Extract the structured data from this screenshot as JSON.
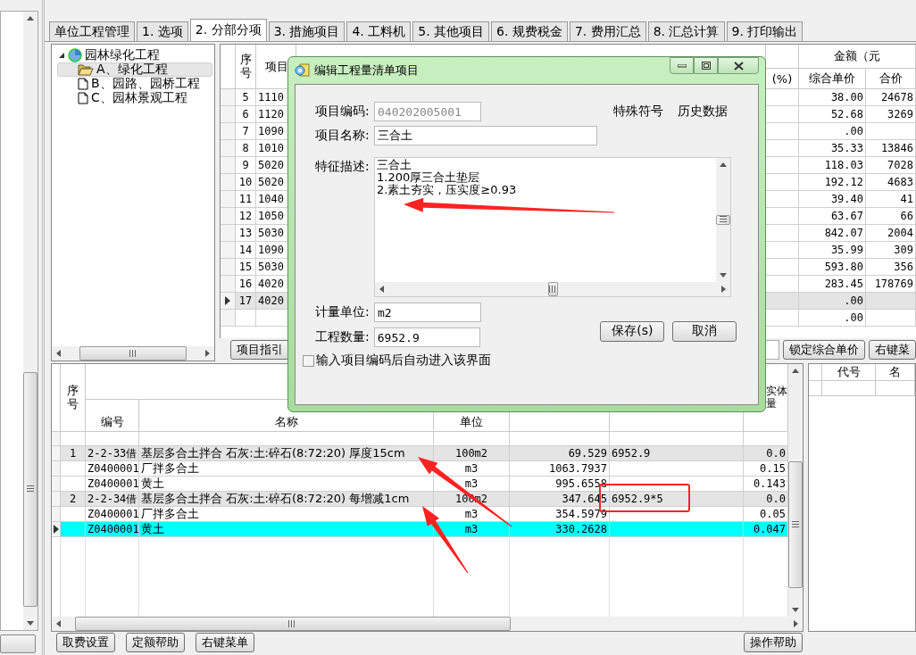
{
  "tabs": [
    {
      "label": "单位工程管理",
      "selected": false
    },
    {
      "label": "1. 选项",
      "selected": false
    },
    {
      "label": "2. 分部分项",
      "selected": true
    },
    {
      "label": "3. 措施项目",
      "selected": false
    },
    {
      "label": "4. 工料机",
      "selected": false
    },
    {
      "label": "5. 其他项目",
      "selected": false
    },
    {
      "label": "6. 规费税金",
      "selected": false
    },
    {
      "label": "7. 费用汇总",
      "selected": false
    },
    {
      "label": "8. 汇总计算",
      "selected": false
    },
    {
      "label": "9. 打印输出",
      "selected": false
    }
  ],
  "tree": {
    "items": [
      {
        "label": "园林绿化工程",
        "kind": "project",
        "expanded": true,
        "selected": false,
        "children": [
          {
            "label": "A、绿化工程",
            "kind": "folder",
            "selected": true
          },
          {
            "label": "B、园路、园桥工程",
            "kind": "document",
            "selected": false
          },
          {
            "label": "C、园林景观工程",
            "kind": "document",
            "selected": false
          }
        ]
      }
    ]
  },
  "upper_table": {
    "header": {
      "seq": "序号",
      "code": "项目",
      "rate": "(%)",
      "amount": "金额（元",
      "unit_price": "综合单价",
      "total": "合价"
    },
    "rows": [
      {
        "seq": "5",
        "code": "1110",
        "unit_price": "38.00",
        "total": "24678",
        "selected": false
      },
      {
        "seq": "6",
        "code": "1120",
        "unit_price": "52.68",
        "total": "3269",
        "selected": false
      },
      {
        "seq": "7",
        "code": "1090",
        "unit_price": ".00",
        "selected": false
      },
      {
        "seq": "8",
        "code": "1010",
        "unit_price": "35.33",
        "total": "13846",
        "selected": false
      },
      {
        "seq": "9",
        "code": "5020",
        "unit_price": "118.03",
        "total": "7028",
        "selected": false
      },
      {
        "seq": "10",
        "code": "5020",
        "unit_price": "192.12",
        "total": "4683",
        "selected": false
      },
      {
        "seq": "11",
        "code": "1040",
        "unit_price": "39.40",
        "total": "41",
        "selected": false
      },
      {
        "seq": "12",
        "code": "1050",
        "unit_price": "63.67",
        "total": "66",
        "selected": false
      },
      {
        "seq": "13",
        "code": "5030",
        "unit_price": "842.07",
        "total": "2004",
        "selected": false
      },
      {
        "seq": "14",
        "code": "1090",
        "unit_price": "35.99",
        "total": "309",
        "selected": false
      },
      {
        "seq": "15",
        "code": "5030",
        "unit_price": "593.80",
        "total": "356",
        "selected": false
      },
      {
        "seq": "16",
        "code": "4020",
        "unit_price": "283.45",
        "total": "178769",
        "selected": false
      },
      {
        "seq": "17",
        "code": "4020",
        "unit_price": ".00",
        "selected": true
      },
      {
        "unit_price": ".00",
        "selected": false
      }
    ]
  },
  "upper_buttons": [
    "项目指引"
  ],
  "upper_right_buttons": [
    "锁定综合单价",
    "右键菜"
  ],
  "lower_table": {
    "header": {
      "seq": "序号",
      "code": "编号",
      "name": "名称",
      "unit": "单位",
      "qty": "实体量"
    },
    "rows": [
      {
        "kind": "group",
        "seq": "1",
        "code": "2-2-33借",
        "name": "基层多合土拌合 石灰:土:碎石(8:72:20) 厚度15cm",
        "unit": "100m2",
        "amount": "69.529",
        "formula": "6952.9",
        "qty": "0.0",
        "selected": false
      },
      {
        "kind": "item",
        "code": "Z0400001",
        "name": "厂拌多合土",
        "unit": "m3",
        "amount": "1063.7937",
        "qty": "0.15",
        "selected": false
      },
      {
        "kind": "item",
        "code": "Z0400001",
        "name": "黄土",
        "unit": "m3",
        "amount": "995.6558",
        "qty": "0.143",
        "selected": false
      },
      {
        "kind": "group",
        "seq": "2",
        "code": "2-2-34借",
        "name": "基层多合土拌合 石灰:土:碎石(8:72:20) 每增减1cm",
        "unit": "100m2",
        "amount": "347.645",
        "formula": "6952.9*5",
        "qty": "0.0",
        "selected": false
      },
      {
        "kind": "item",
        "code": "Z0400001",
        "name": "厂拌多合土",
        "unit": "m3",
        "amount": "354.5979",
        "qty": "0.05",
        "selected": false
      },
      {
        "kind": "item",
        "code": "Z0400001",
        "name": "黄土",
        "unit": "m3",
        "amount": "330.2628",
        "qty": "0.047",
        "selected": true
      }
    ]
  },
  "side_table": {
    "columns": [
      "代号",
      "名"
    ]
  },
  "bottom_buttons": [
    "取费设置",
    "定额帮助",
    "右键菜单"
  ],
  "help_button": "操作帮助",
  "dialog": {
    "title": "编辑工程量清单项目",
    "code": {
      "label": "项目编码:",
      "value": "040202005001",
      "disabled": true
    },
    "links": [
      "特殊符号",
      "历史数据"
    ],
    "name": {
      "label": "项目名称:",
      "value": "三合土"
    },
    "description": {
      "label": "特征描述:",
      "lines": [
        "三合土",
        "1.200厚三合土垫层",
        "2.素土夯实，压实度≥0.93"
      ]
    },
    "unit": {
      "label": "计量单位:",
      "value": "m2"
    },
    "quantity": {
      "label": "工程数量:",
      "value": "6952.9"
    },
    "buttons": [
      "保存(s)",
      "取消"
    ],
    "auto_enter": {
      "label": "输入项目编码后自动进入该界面",
      "checked": false
    }
  }
}
